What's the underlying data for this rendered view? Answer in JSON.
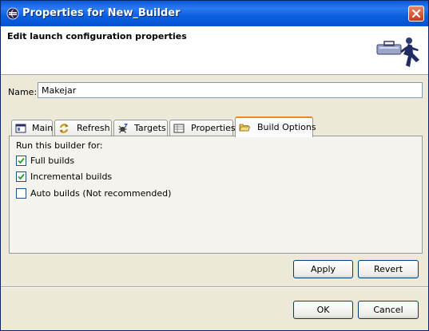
{
  "window": {
    "title": "Properties for New_Builder"
  },
  "header": {
    "title": "Edit launch configuration properties"
  },
  "name_field": {
    "label": "Name:",
    "value": "Makejar"
  },
  "tabs": [
    {
      "label": "Main",
      "icon": "main-tab-icon"
    },
    {
      "label": "Refresh",
      "icon": "refresh-icon"
    },
    {
      "label": "Targets",
      "icon": "targets-icon"
    },
    {
      "label": "Properties",
      "icon": "properties-table-icon"
    },
    {
      "label": "Build Options",
      "icon": "folder-open-icon",
      "selected": true
    }
  ],
  "build_options": {
    "heading": "Run this builder for:",
    "options": [
      {
        "label": "Full builds",
        "checked": true
      },
      {
        "label": "Incremental builds",
        "checked": true
      },
      {
        "label": "Auto builds (Not recommended)",
        "checked": false
      }
    ]
  },
  "buttons": {
    "apply": "Apply",
    "revert": "Revert",
    "ok": "OK",
    "cancel": "Cancel"
  },
  "colors": {
    "title_bar": "#0a5ad7",
    "dialog_bg": "#ece9d8",
    "tab_highlight": "#e68b2c",
    "close_button": "#c8381a"
  }
}
